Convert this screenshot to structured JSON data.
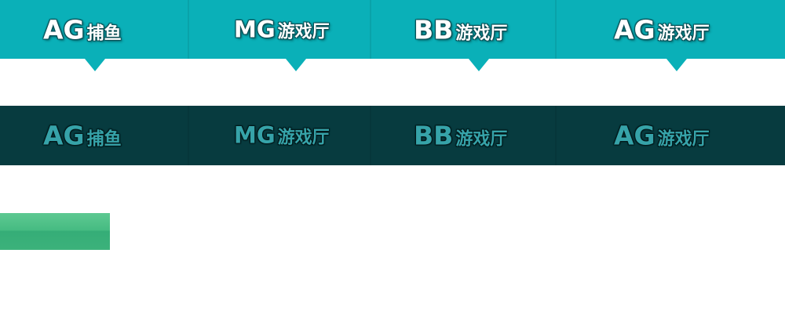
{
  "tabs": [
    {
      "code": "AG",
      "name": "捕鱼"
    },
    {
      "code": "MG",
      "name": "游戏厅"
    },
    {
      "code": "BB",
      "name": "游戏厅"
    },
    {
      "code": "AG",
      "name": "游戏厅"
    }
  ],
  "colors": {
    "active_bar": "#0ab0b8",
    "inactive_bar": "#073b3f",
    "inactive_text": "#36a3a9",
    "active_text": "#ffffff",
    "green_bar": "#46bb82"
  }
}
